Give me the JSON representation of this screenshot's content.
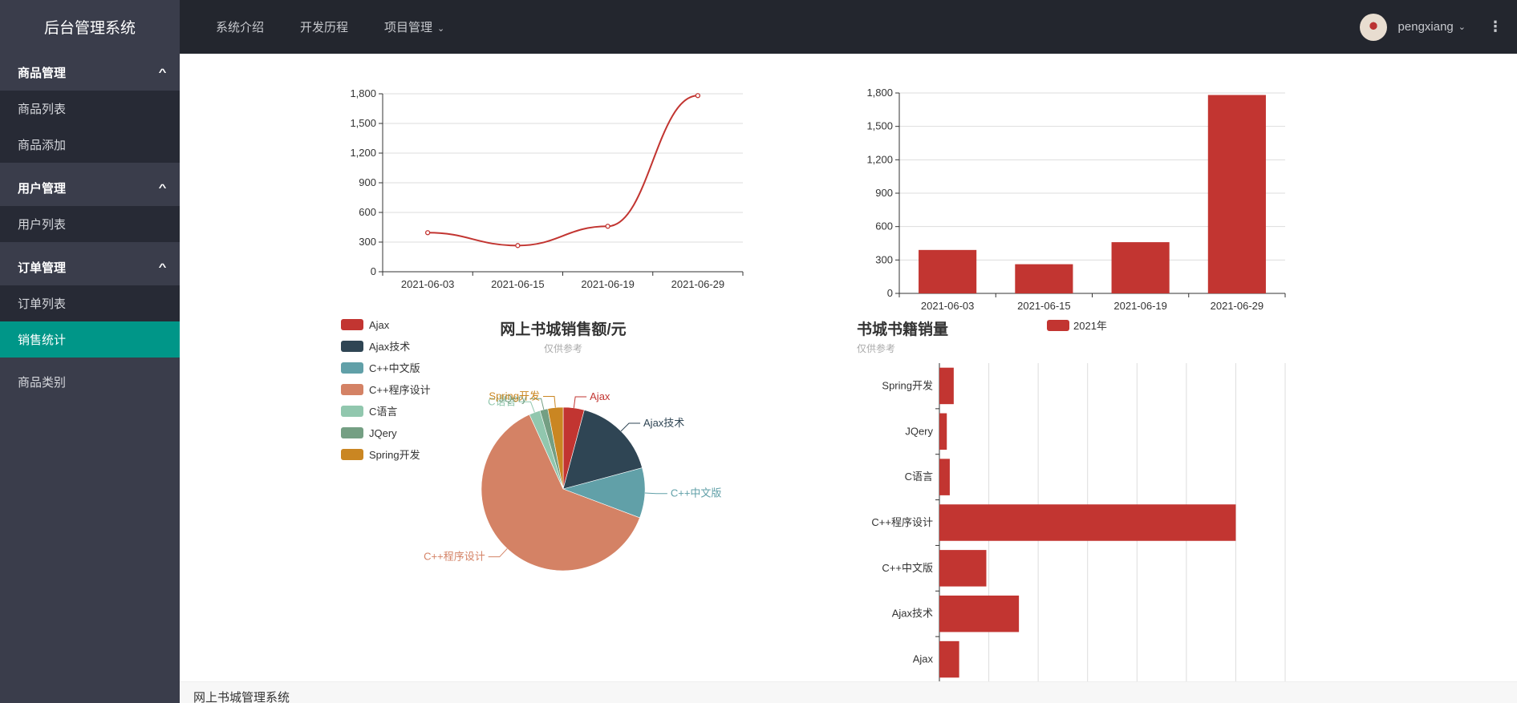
{
  "app": {
    "title": "后台管理系统"
  },
  "topnav": [
    {
      "label": "系统介绍"
    },
    {
      "label": "开发历程"
    },
    {
      "label": "项目管理",
      "has_dropdown": true
    }
  ],
  "user": {
    "name": "pengxiang",
    "avatar_icon": "avatar-image",
    "more_icon": "vertical-dots-icon"
  },
  "sidebar": {
    "groups": [
      {
        "label": "商品管理",
        "items": [
          {
            "label": "商品列表"
          },
          {
            "label": "商品添加"
          }
        ]
      },
      {
        "label": "用户管理",
        "items": [
          {
            "label": "用户列表"
          }
        ]
      },
      {
        "label": "订单管理",
        "items": [
          {
            "label": "订单列表"
          },
          {
            "label": "销售统计",
            "active": true
          }
        ]
      }
    ],
    "plain_items": [
      {
        "label": "商品类别"
      }
    ]
  },
  "footer": {
    "text": "网上书城管理系统"
  },
  "colors": {
    "accent": "#009688",
    "series": "#c23531",
    "sidebar": "#3a3d4b",
    "topbar": "#23262e"
  },
  "chart_data": [
    {
      "type": "line",
      "smooth": true,
      "categories": [
        "2021-06-03",
        "2021-06-15",
        "2021-06-19",
        "2021-06-29"
      ],
      "values": [
        395,
        265,
        460,
        1782
      ],
      "ylim": [
        0,
        1800
      ],
      "yticks": [
        "0",
        "300",
        "600",
        "900",
        "1,200",
        "1,500",
        "1,800"
      ],
      "grid": true,
      "color": "#c23531"
    },
    {
      "type": "bar",
      "categories": [
        "2021-06-03",
        "2021-06-15",
        "2021-06-19",
        "2021-06-29"
      ],
      "values": [
        390,
        262,
        460,
        1782
      ],
      "ylim": [
        0,
        1800
      ],
      "yticks": [
        "0",
        "300",
        "600",
        "900",
        "1,200",
        "1,500",
        "1,800"
      ],
      "grid": true,
      "color": "#c23531"
    },
    {
      "type": "pie",
      "title": "网上书城销售额/元",
      "subtitle": "仅供参考",
      "legend_position": "left",
      "slices": [
        {
          "name": "Ajax",
          "value": 400,
          "color": "#c23531"
        },
        {
          "name": "Ajax技术",
          "value": 1600,
          "color": "#2f4554"
        },
        {
          "name": "C++中文版",
          "value": 950,
          "color": "#61a0a8"
        },
        {
          "name": "C++程序设计",
          "value": 6000,
          "color": "#d48265"
        },
        {
          "name": "C语言",
          "value": 210,
          "color": "#91c7ae"
        },
        {
          "name": "JQery",
          "value": 150,
          "color": "#749f83"
        },
        {
          "name": "Spring开发",
          "value": 290,
          "color": "#ca8622"
        }
      ]
    },
    {
      "type": "bar",
      "orientation": "horizontal",
      "title": "书城书籍销量",
      "subtitle": "仅供参考",
      "legend": [
        "2021年"
      ],
      "legend_position": "top",
      "categories": [
        "Ajax",
        "Ajax技术",
        "C++中文版",
        "C++程序设计",
        "C语言",
        "JQery",
        "Spring开发"
      ],
      "values": [
        400,
        1610,
        950,
        6000,
        210,
        150,
        290
      ],
      "xlim": [
        0,
        7000
      ],
      "grid": true,
      "color": "#c23531"
    }
  ]
}
